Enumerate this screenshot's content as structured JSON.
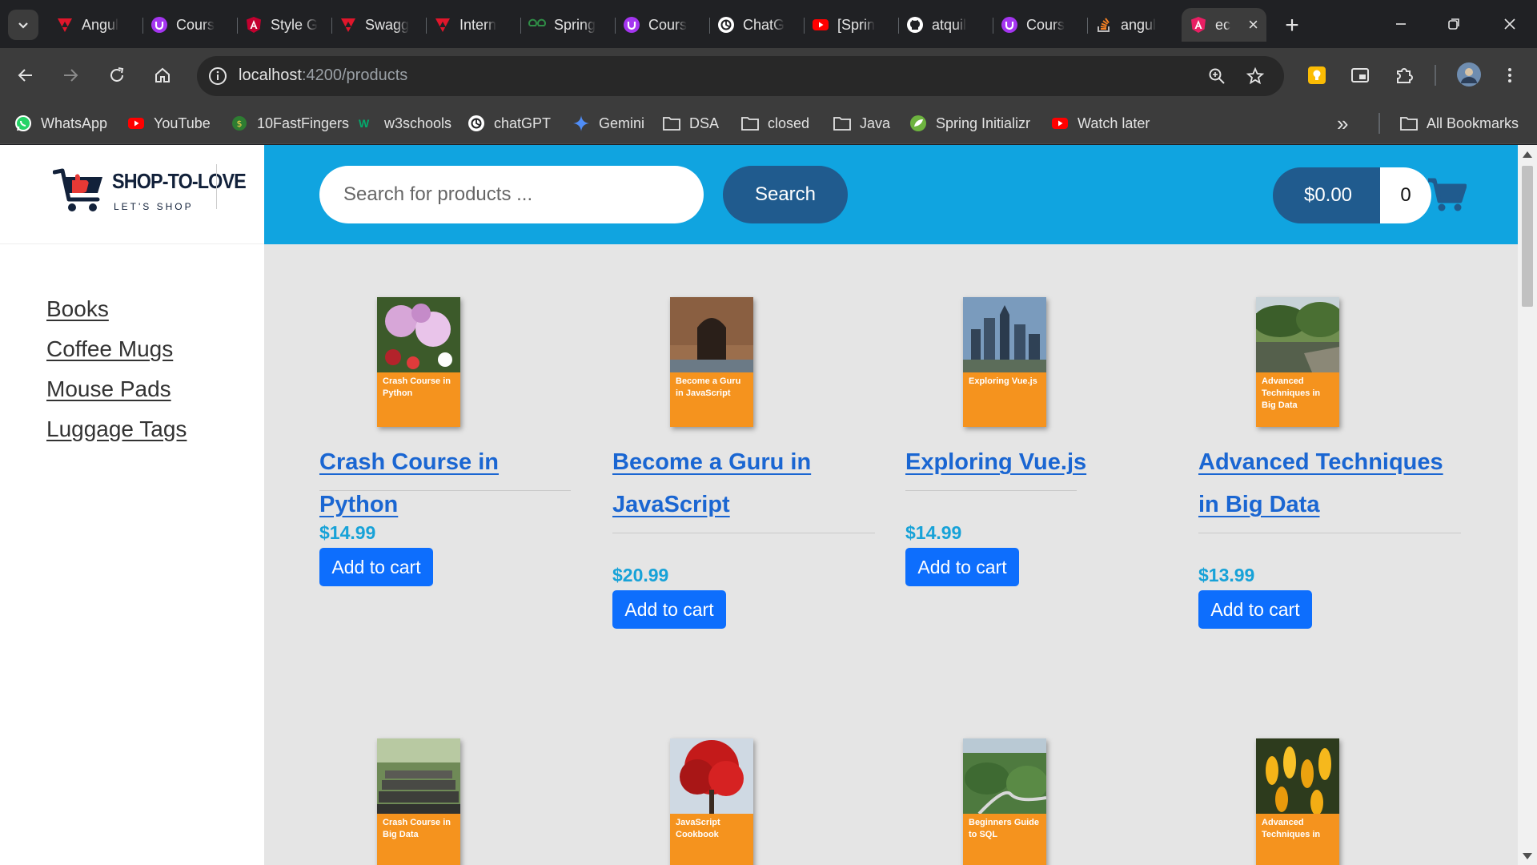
{
  "browser": {
    "tabs": [
      {
        "title": "Angul",
        "icon": "angular-red-icon",
        "color": "#e0162b"
      },
      {
        "title": "Cours",
        "icon": "udemy-icon",
        "color": "#a435f0"
      },
      {
        "title": "Style G",
        "icon": "angular-icon",
        "color": "#c3002f"
      },
      {
        "title": "Swagg",
        "icon": "angular-red-icon",
        "color": "#e0162b"
      },
      {
        "title": "Intern",
        "icon": "angular-red-icon",
        "color": "#e0162b"
      },
      {
        "title": "Spring",
        "icon": "geeksforgeeks-icon",
        "color": "#2f8d46"
      },
      {
        "title": "Cours",
        "icon": "udemy-icon",
        "color": "#a435f0"
      },
      {
        "title": "ChatG",
        "icon": "chatgpt-icon",
        "color": "#ffffff"
      },
      {
        "title": "[Sprin",
        "icon": "youtube-icon",
        "color": "#ff0000"
      },
      {
        "title": "atquil",
        "icon": "github-icon",
        "color": "#ffffff"
      },
      {
        "title": "Cours",
        "icon": "udemy-icon",
        "color": "#a435f0"
      },
      {
        "title": "angul",
        "icon": "stackoverflow-icon",
        "color": "#f48024"
      }
    ],
    "active_tab": {
      "title": "ec",
      "icon": "angular-icon",
      "close": "×"
    },
    "new_tab": "+",
    "window": {
      "minimize": "—",
      "maximize": "❐",
      "close": "✕"
    },
    "url_host": "localhost",
    "url_path": ":4200/products",
    "bookmarks": [
      {
        "label": "WhatsApp",
        "icon": "whatsapp-icon"
      },
      {
        "label": "YouTube",
        "icon": "youtube-icon"
      },
      {
        "label": "10FastFingers",
        "icon": "10fastfingers-icon"
      },
      {
        "label": "w3schools",
        "icon": "w3schools-icon"
      },
      {
        "label": "chatGPT",
        "icon": "chatgpt-icon"
      },
      {
        "label": "Gemini",
        "icon": "gemini-icon"
      },
      {
        "label": "DSA",
        "icon": "folder-icon"
      },
      {
        "label": "closed",
        "icon": "folder-icon"
      },
      {
        "label": "Java",
        "icon": "folder-icon"
      },
      {
        "label": "Spring Initializr",
        "icon": "spring-icon"
      },
      {
        "label": "Watch later",
        "icon": "youtube-icon"
      }
    ],
    "bookmarks_overflow": "»",
    "all_bookmarks": "All Bookmarks"
  },
  "shop": {
    "logo_title": "SHOP-TO-LOVE",
    "logo_tagline": "LET'S SHOP",
    "categories": [
      "Books",
      "Coffee Mugs",
      "Mouse Pads",
      "Luggage Tags"
    ],
    "search_placeholder": "Search for products ...",
    "search_button": "Search",
    "cart_total": "$0.00",
    "cart_quantity": "0",
    "colors": {
      "header": "#10a4e0",
      "dark_blue": "#205b8e",
      "link": "#1a66d2",
      "price": "#17a2d8",
      "button": "#0d6efd",
      "cover": "#f5931e"
    }
  },
  "products": [
    {
      "name": "Crash Course in Python",
      "cover_text": "Crash Course in Python",
      "price": "$14.99",
      "button": "Add to cart"
    },
    {
      "name": "Become a Guru in JavaScript",
      "cover_text": "Become a Guru in JavaScript",
      "price": "$20.99",
      "button": "Add to cart"
    },
    {
      "name": "Exploring Vue.js",
      "cover_text": "Exploring Vue.js",
      "price": "$14.99",
      "button": "Add to cart"
    },
    {
      "name": "Advanced Techniques in Big Data",
      "cover_text": "Advanced Techniques in Big Data",
      "price": "$13.99",
      "button": "Add to cart"
    }
  ],
  "products_row2": [
    {
      "cover_text": "Crash Course in Big Data"
    },
    {
      "cover_text": "JavaScript Cookbook"
    },
    {
      "cover_text": "Beginners Guide to SQL"
    },
    {
      "cover_text": "Advanced Techniques in"
    }
  ]
}
